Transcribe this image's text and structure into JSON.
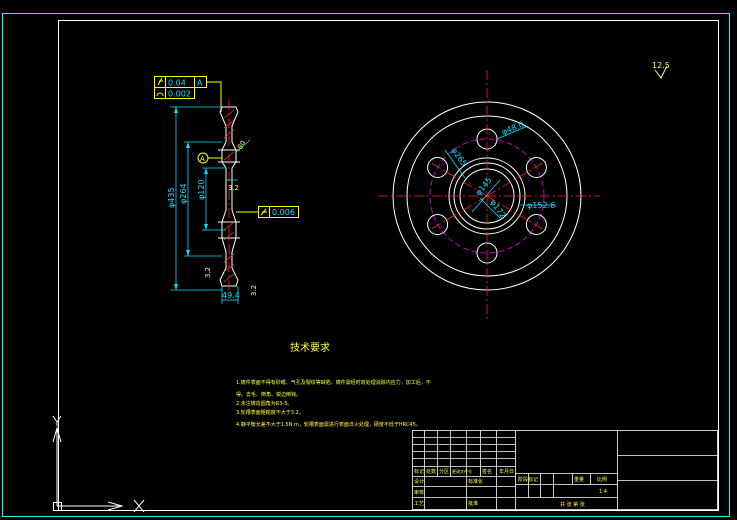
{
  "colors": {
    "background": "#000000",
    "frame_outer": "#00ffff",
    "frame_inner": "#ffffff",
    "dimension": "#00e0ff",
    "geometry": "#ffffff",
    "centerline": "#ff2020",
    "hidden_circle": "#c000c0",
    "hatch": "#ff3030",
    "tolerance_box": "#ffff00",
    "text_yellow": "#ffff40",
    "ucs": "#ffffff"
  },
  "icons": {
    "ucs": "ucs-axis-icon",
    "roughness": "surface-roughness-icon",
    "flatness": "flatness-symbol-icon",
    "circularity": "circularity-symbol-icon"
  },
  "section_view": {
    "tolerance_1": {
      "value": "0.04",
      "datum": "A"
    },
    "tolerance_2": {
      "value": "0.002"
    },
    "tolerance_3": {
      "value": "0.006"
    },
    "datum_label": "A",
    "dims": {
      "d_outer": "φ435",
      "d_mid": "φ264",
      "d_hub": "φ120",
      "angle": "80",
      "r_top": "3.2",
      "r_side": "3.2",
      "r_bottom": "3.2",
      "width": "49.4"
    }
  },
  "front_view": {
    "dims": {
      "hole": "φ48.0",
      "pcd": "φ265",
      "bore": "φ145",
      "bore2": "φ172",
      "hub_od": "φ152.6"
    }
  },
  "roughness_top": "12.5",
  "tech_req": {
    "title": "技术要求",
    "lines": [
      "1.铸件表面不得有砂眼、气孔及裂纹等缺陷，铸件需经时效处理消除内应力，加工后，不",
      "得。去毛、倒角、锐边倒钝。",
      "2.未注铸造圆角为R3-5。",
      "3.轮槽表面粗糙度不大于3.2。",
      "4.静平衡允差不大于1.5N.m，轮槽表面需进行表面淬火处理，硬度不低于HRC45。"
    ]
  },
  "title_block": {
    "r1": [
      "",
      "",
      "",
      "",
      "",
      "",
      ""
    ],
    "labels": [
      "标记",
      "处数",
      "分区",
      "更改文件号",
      "签名",
      "年月日"
    ],
    "labels2": [
      "设计",
      "",
      "标准化",
      ""
    ],
    "stage_label": "阶段标记",
    "weight_label": "重量",
    "scale_label": "比例",
    "scale_value": "1:4",
    "row3": [
      "审核",
      ""
    ],
    "row4": [
      "工艺",
      "",
      "批准",
      ""
    ],
    "sheet_label": "共 张 第 张"
  }
}
